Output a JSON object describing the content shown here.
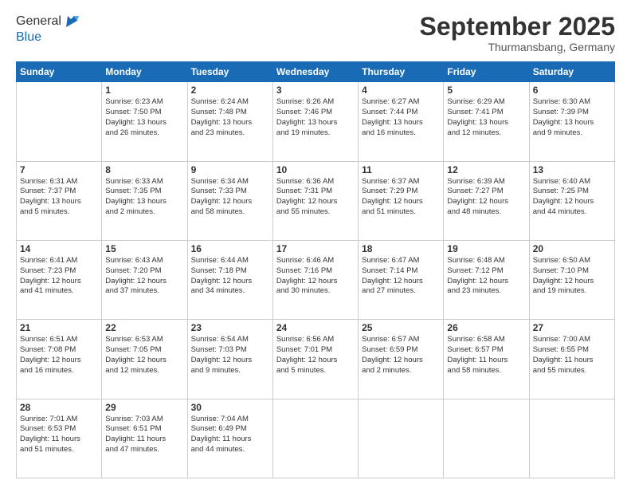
{
  "logo": {
    "line1": "General",
    "line2": "Blue"
  },
  "title": "September 2025",
  "subtitle": "Thurmansbang, Germany",
  "header_days": [
    "Sunday",
    "Monday",
    "Tuesday",
    "Wednesday",
    "Thursday",
    "Friday",
    "Saturday"
  ],
  "weeks": [
    [
      {
        "day": "",
        "detail": ""
      },
      {
        "day": "1",
        "detail": "Sunrise: 6:23 AM\nSunset: 7:50 PM\nDaylight: 13 hours\nand 26 minutes."
      },
      {
        "day": "2",
        "detail": "Sunrise: 6:24 AM\nSunset: 7:48 PM\nDaylight: 13 hours\nand 23 minutes."
      },
      {
        "day": "3",
        "detail": "Sunrise: 6:26 AM\nSunset: 7:46 PM\nDaylight: 13 hours\nand 19 minutes."
      },
      {
        "day": "4",
        "detail": "Sunrise: 6:27 AM\nSunset: 7:44 PM\nDaylight: 13 hours\nand 16 minutes."
      },
      {
        "day": "5",
        "detail": "Sunrise: 6:29 AM\nSunset: 7:41 PM\nDaylight: 13 hours\nand 12 minutes."
      },
      {
        "day": "6",
        "detail": "Sunrise: 6:30 AM\nSunset: 7:39 PM\nDaylight: 13 hours\nand 9 minutes."
      }
    ],
    [
      {
        "day": "7",
        "detail": "Sunrise: 6:31 AM\nSunset: 7:37 PM\nDaylight: 13 hours\nand 5 minutes."
      },
      {
        "day": "8",
        "detail": "Sunrise: 6:33 AM\nSunset: 7:35 PM\nDaylight: 13 hours\nand 2 minutes."
      },
      {
        "day": "9",
        "detail": "Sunrise: 6:34 AM\nSunset: 7:33 PM\nDaylight: 12 hours\nand 58 minutes."
      },
      {
        "day": "10",
        "detail": "Sunrise: 6:36 AM\nSunset: 7:31 PM\nDaylight: 12 hours\nand 55 minutes."
      },
      {
        "day": "11",
        "detail": "Sunrise: 6:37 AM\nSunset: 7:29 PM\nDaylight: 12 hours\nand 51 minutes."
      },
      {
        "day": "12",
        "detail": "Sunrise: 6:39 AM\nSunset: 7:27 PM\nDaylight: 12 hours\nand 48 minutes."
      },
      {
        "day": "13",
        "detail": "Sunrise: 6:40 AM\nSunset: 7:25 PM\nDaylight: 12 hours\nand 44 minutes."
      }
    ],
    [
      {
        "day": "14",
        "detail": "Sunrise: 6:41 AM\nSunset: 7:23 PM\nDaylight: 12 hours\nand 41 minutes."
      },
      {
        "day": "15",
        "detail": "Sunrise: 6:43 AM\nSunset: 7:20 PM\nDaylight: 12 hours\nand 37 minutes."
      },
      {
        "day": "16",
        "detail": "Sunrise: 6:44 AM\nSunset: 7:18 PM\nDaylight: 12 hours\nand 34 minutes."
      },
      {
        "day": "17",
        "detail": "Sunrise: 6:46 AM\nSunset: 7:16 PM\nDaylight: 12 hours\nand 30 minutes."
      },
      {
        "day": "18",
        "detail": "Sunrise: 6:47 AM\nSunset: 7:14 PM\nDaylight: 12 hours\nand 27 minutes."
      },
      {
        "day": "19",
        "detail": "Sunrise: 6:48 AM\nSunset: 7:12 PM\nDaylight: 12 hours\nand 23 minutes."
      },
      {
        "day": "20",
        "detail": "Sunrise: 6:50 AM\nSunset: 7:10 PM\nDaylight: 12 hours\nand 19 minutes."
      }
    ],
    [
      {
        "day": "21",
        "detail": "Sunrise: 6:51 AM\nSunset: 7:08 PM\nDaylight: 12 hours\nand 16 minutes."
      },
      {
        "day": "22",
        "detail": "Sunrise: 6:53 AM\nSunset: 7:05 PM\nDaylight: 12 hours\nand 12 minutes."
      },
      {
        "day": "23",
        "detail": "Sunrise: 6:54 AM\nSunset: 7:03 PM\nDaylight: 12 hours\nand 9 minutes."
      },
      {
        "day": "24",
        "detail": "Sunrise: 6:56 AM\nSunset: 7:01 PM\nDaylight: 12 hours\nand 5 minutes."
      },
      {
        "day": "25",
        "detail": "Sunrise: 6:57 AM\nSunset: 6:59 PM\nDaylight: 12 hours\nand 2 minutes."
      },
      {
        "day": "26",
        "detail": "Sunrise: 6:58 AM\nSunset: 6:57 PM\nDaylight: 11 hours\nand 58 minutes."
      },
      {
        "day": "27",
        "detail": "Sunrise: 7:00 AM\nSunset: 6:55 PM\nDaylight: 11 hours\nand 55 minutes."
      }
    ],
    [
      {
        "day": "28",
        "detail": "Sunrise: 7:01 AM\nSunset: 6:53 PM\nDaylight: 11 hours\nand 51 minutes."
      },
      {
        "day": "29",
        "detail": "Sunrise: 7:03 AM\nSunset: 6:51 PM\nDaylight: 11 hours\nand 47 minutes."
      },
      {
        "day": "30",
        "detail": "Sunrise: 7:04 AM\nSunset: 6:49 PM\nDaylight: 11 hours\nand 44 minutes."
      },
      {
        "day": "",
        "detail": ""
      },
      {
        "day": "",
        "detail": ""
      },
      {
        "day": "",
        "detail": ""
      },
      {
        "day": "",
        "detail": ""
      }
    ]
  ]
}
